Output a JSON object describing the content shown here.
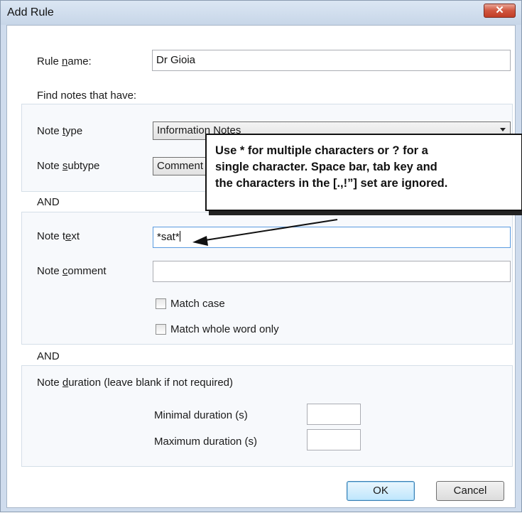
{
  "dialog": {
    "title": "Add Rule",
    "close_glyph": "✕"
  },
  "rule_name": {
    "label_pre": "Rule ",
    "label_key": "n",
    "label_post": "ame:",
    "value": "Dr Gioia"
  },
  "find_label": "Find notes that have:",
  "note_type": {
    "label_pre": "Note ",
    "label_key": "t",
    "label_post": "ype",
    "value": "Information Notes"
  },
  "note_subtype": {
    "label_pre": "Note ",
    "label_key": "s",
    "label_post": "ubtype",
    "value": "Comment"
  },
  "and_1": "AND",
  "note_text": {
    "label_pre": "Note t",
    "label_key": "e",
    "label_post": "xt",
    "value": "*sat*"
  },
  "note_comment": {
    "label_pre": "Note ",
    "label_key": "c",
    "label_post": "omment",
    "value": ""
  },
  "match_case": {
    "label": "Match case",
    "checked": false
  },
  "match_whole": {
    "label": "Match whole word only",
    "checked": false
  },
  "and_2": "AND",
  "duration": {
    "label_pre": "Note ",
    "label_key": "d",
    "label_post": "uration (leave blank if not required)",
    "min_label": "Minimal duration (s)",
    "min_value": "",
    "max_label": "Maximum duration (s)",
    "max_value": ""
  },
  "buttons": {
    "ok": "OK",
    "cancel": "Cancel"
  },
  "callout": {
    "line1": "Use * for multiple characters or ? for a",
    "line2": "single character.  Space bar, tab key and",
    "line3": "the characters in the [.,!”] set are ignored."
  },
  "colors": {
    "accent_focus": "#5a9be0",
    "close_red": "#c23e26",
    "titlebar": "#c7d6e8"
  }
}
